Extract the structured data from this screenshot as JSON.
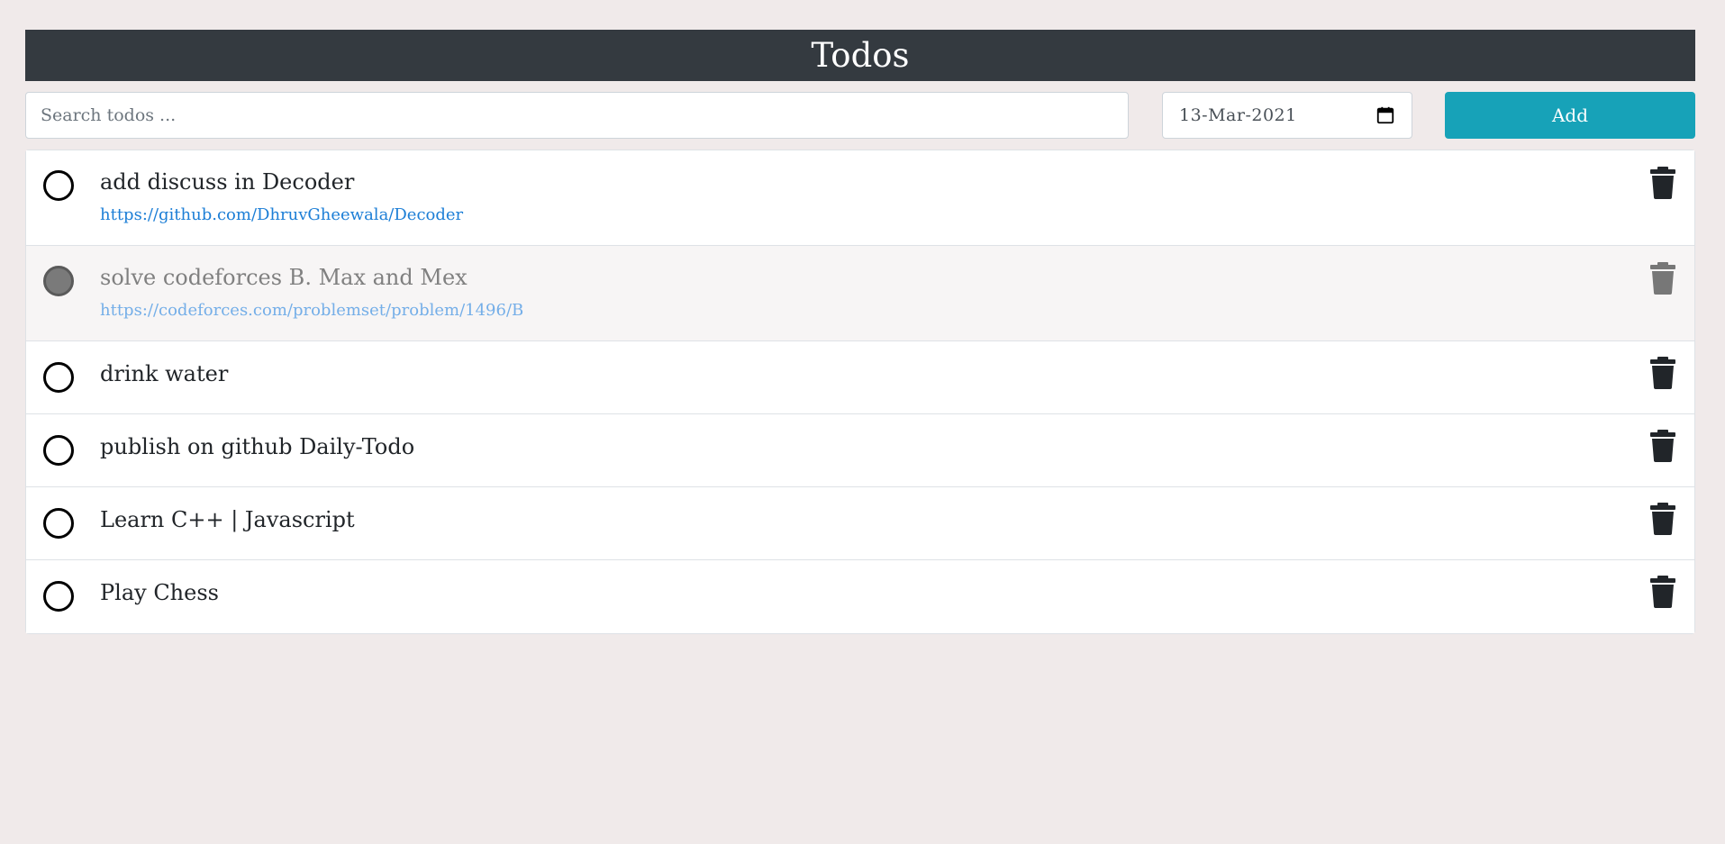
{
  "header": {
    "title": "Todos"
  },
  "search": {
    "placeholder": "Search todos ..."
  },
  "date": {
    "value": "13-Mar-2021",
    "icon": "calendar-icon"
  },
  "add_button": {
    "label": "Add",
    "color": "#17a2b8"
  },
  "todos": [
    {
      "title": "add discuss in Decoder",
      "link": "https://github.com/DhruvGheewala/Decoder",
      "done": false
    },
    {
      "title": "solve codeforces B. Max and Mex",
      "link": "https://codeforces.com/problemset/problem/1496/B",
      "done": true
    },
    {
      "title": "drink water",
      "link": "",
      "done": false
    },
    {
      "title": "publish on github Daily-Todo",
      "link": "",
      "done": false
    },
    {
      "title": "Learn C++ | Javascript",
      "link": "",
      "done": false
    },
    {
      "title": "Play Chess",
      "link": "",
      "done": false
    }
  ],
  "icons": {
    "check": "circle-check-icon",
    "delete": "trash-icon"
  },
  "colors": {
    "header_bg": "#343a40",
    "page_bg": "#f0eaea",
    "link": "#1c7ed6"
  }
}
